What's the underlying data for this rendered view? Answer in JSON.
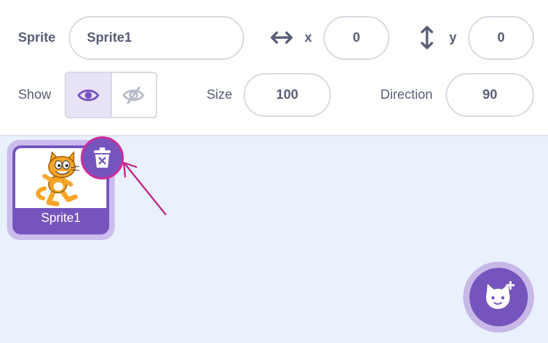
{
  "info": {
    "sprite_label": "Sprite",
    "sprite_name": "Sprite1",
    "x_label": "x",
    "x_value": "0",
    "y_label": "y",
    "y_value": "0",
    "show_label": "Show",
    "size_label": "Size",
    "size_value": "100",
    "direction_label": "Direction",
    "direction_value": "90",
    "show_state": "visible"
  },
  "sprites": [
    {
      "name": "Sprite1",
      "selected": true
    }
  ],
  "icons": {
    "x_axis": "horizontal-arrows-icon",
    "y_axis": "vertical-arrows-icon",
    "show": "eye-icon",
    "hide": "eye-slash-icon",
    "delete": "trash-icon",
    "add": "add-sprite-cat-icon"
  },
  "colors": {
    "accent": "#7555bd",
    "highlight": "#cf2b9a",
    "pane_bg": "#e9f1fc",
    "text": "#575e75"
  }
}
